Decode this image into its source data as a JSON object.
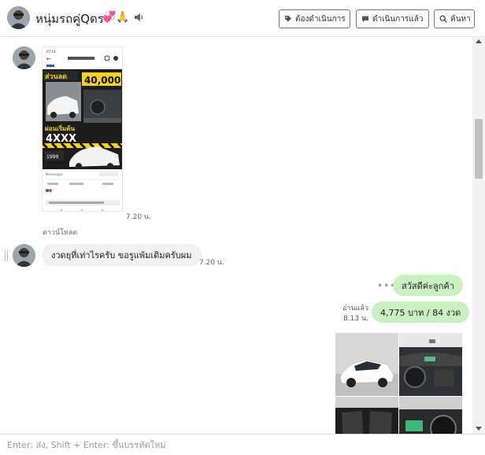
{
  "header": {
    "title": "หนุ่มรถคู่Qดร",
    "emoji": "💞🙏",
    "buttons": {
      "pending": "ต้องดำเนินการ",
      "done": "ดำเนินการแล้ว",
      "search": "ค้นหา"
    }
  },
  "messages": {
    "image_time": "7.20 น.",
    "download_label": "ดาวน์โหลด",
    "incoming_text": "งวดยุที่เท่าไรครับ ขอรูแพ้มเติมครับผม",
    "incoming_time": "7.20 น.",
    "greeting": "สวัสดีค่ะลูกค้า",
    "price": "4,775 บาท / 84 งวด",
    "read_label": "อ่านแล้ว",
    "read_time": "8.13 น."
  },
  "screenshot_card": {
    "discount_label": "ส่วนลด",
    "discount_value": "40,000.",
    "down_label": "ผ่อนเริ่มต้น",
    "down_value": "4XXX"
  },
  "composer": {
    "placeholder": "Enter: ส่ง, Shift + Enter: ขึ้นบรรทัดใหม่"
  },
  "colors": {
    "incoming_bubble": "#eef0f2",
    "outgoing_bubble": "#c8f0c0",
    "accent_yellow": "#f2d21b"
  }
}
